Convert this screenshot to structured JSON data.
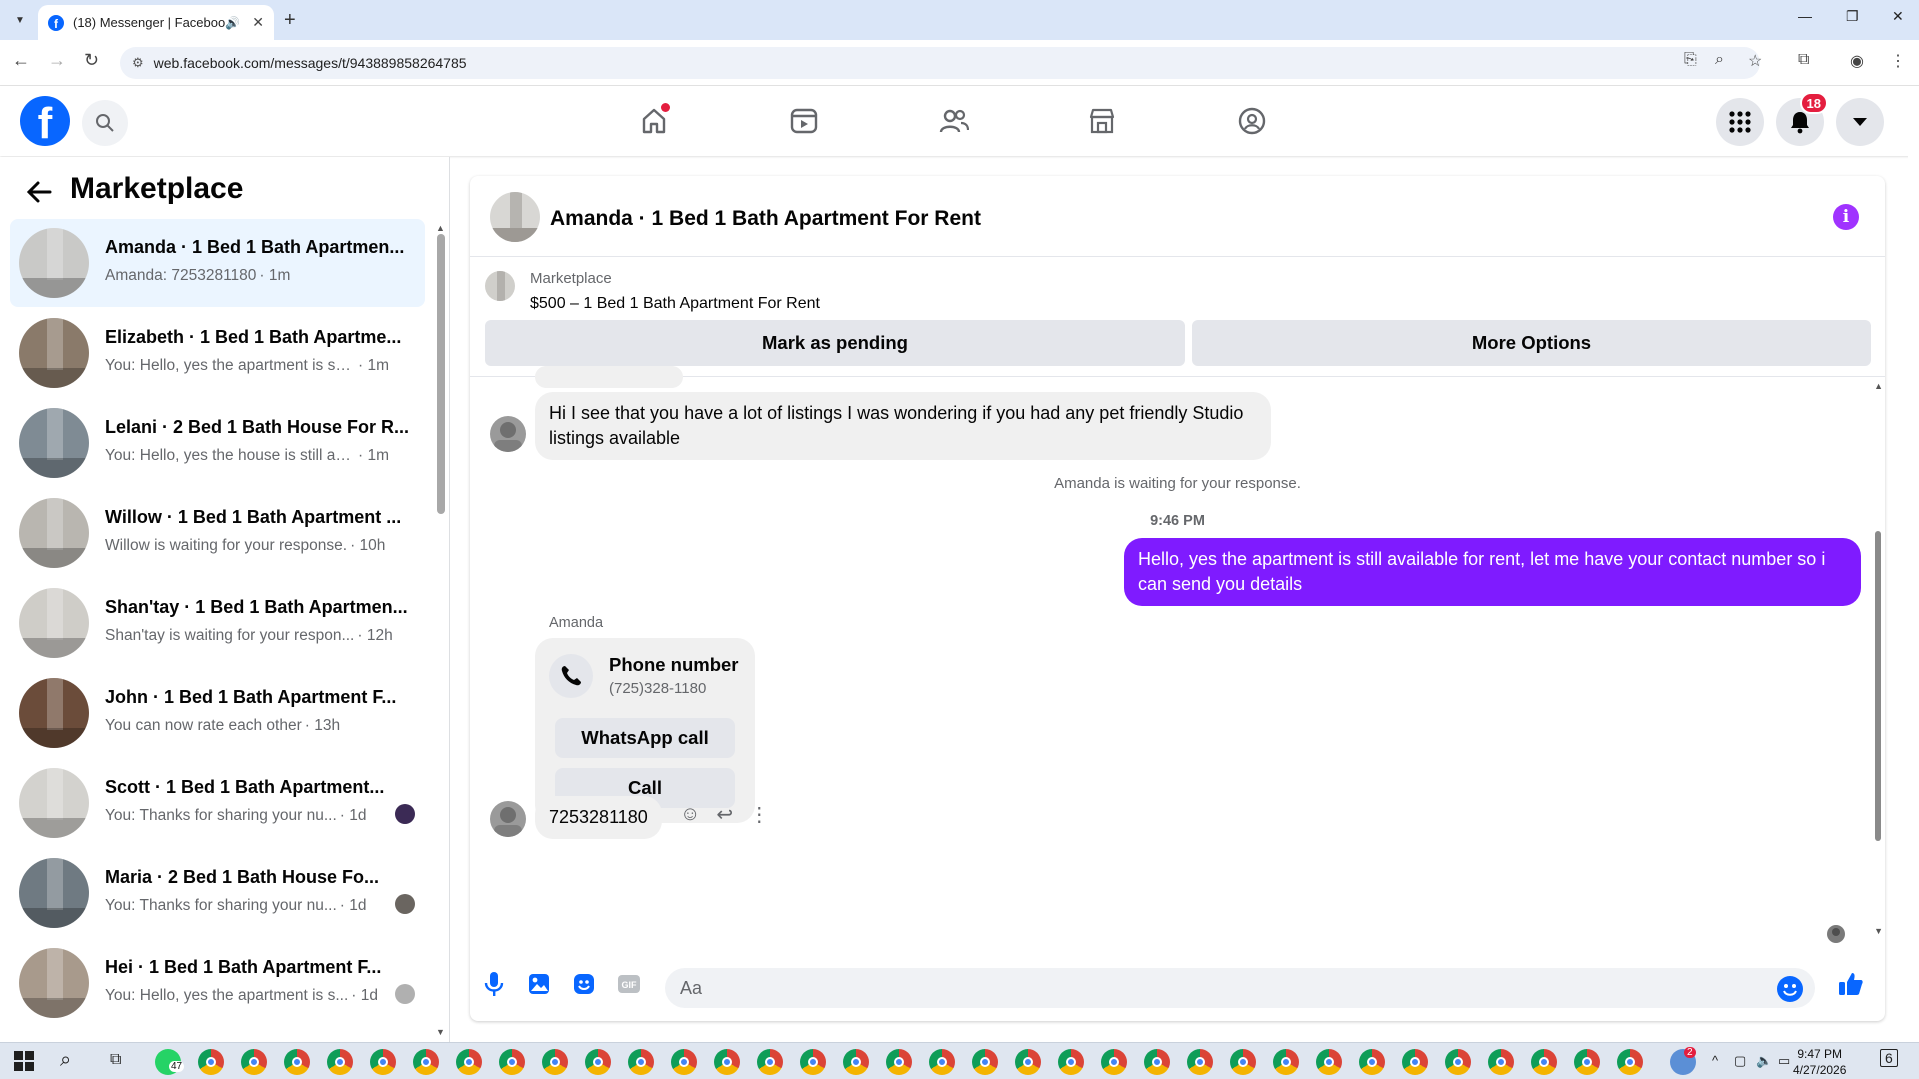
{
  "browser": {
    "tab_title": "(18) Messenger | Facebook",
    "tab_audio_icon": "speaker-icon",
    "url": "web.facebook.com/messages/t/943889858264785"
  },
  "fb_header": {
    "notification_count": "18",
    "nav_icons": [
      "home-icon",
      "video-icon",
      "friends-icon",
      "marketplace-icon",
      "groups-icon"
    ]
  },
  "sidebar": {
    "title": "Marketplace",
    "conversations": [
      {
        "name": "Amanda · 1 Bed 1 Bath Apartmen...",
        "preview": "Amanda: 7253281180",
        "time": " · 1m",
        "active": true,
        "thumb_color": "#c9c9c7"
      },
      {
        "name": "Elizabeth · 1 Bed 1 Bath Apartme...",
        "preview": "You: Hello, yes the apartment is still...",
        "time": " · 1m",
        "thumb_color": "#8a7a6a"
      },
      {
        "name": "Lelani · 2 Bed 1 Bath House For R...",
        "preview": "You: Hello, yes the house is still ava...",
        "time": " · 1m",
        "thumb_color": "#7f8b94"
      },
      {
        "name": "Willow · 1 Bed 1 Bath Apartment ...",
        "preview": "Willow is waiting for your response.",
        "time": " · 10h",
        "thumb_color": "#b9b6b0"
      },
      {
        "name": "Shan'tay · 1 Bed 1 Bath Apartmen...",
        "preview": "Shan'tay is waiting for your respon...",
        "time": " · 12h",
        "thumb_color": "#cfcdc8"
      },
      {
        "name": "John · 1 Bed 1 Bath Apartment F...",
        "preview": "You can now rate each other",
        "time": " · 13h",
        "thumb_color": "#6b4c3a"
      },
      {
        "name": "Scott · 1 Bed 1 Bath Apartment...",
        "preview": "You: Thanks for sharing your nu...",
        "time": " · 1d",
        "thumb_color": "#d3d2ce"
      },
      {
        "name": "Maria · 2 Bed 1 Bath House Fo...",
        "preview": "You: Thanks for sharing your nu...",
        "time": " · 1d",
        "thumb_color": "#6f7a82"
      },
      {
        "name": "Hei · 1 Bed 1 Bath Apartment F...",
        "preview": "You: Hello, yes the apartment is s...",
        "time": " · 1d",
        "thumb_color": "#a89a8c"
      }
    ]
  },
  "chat": {
    "title": "Amanda · 1 Bed 1 Bath Apartment For Rent",
    "marketplace_label": "Marketplace",
    "listing": "$500 – 1 Bed 1 Bath Apartment For Rent",
    "mark_pending": "Mark as pending",
    "more_options": "More Options",
    "incoming_1": "Hi I see that you have a lot of listings I was wondering if you had any pet friendly Studio listings available",
    "waiting_notice": "Amanda is waiting for your response.",
    "timestamp": "9:46 PM",
    "outgoing_1": "Hello, yes the apartment  is still available for rent, let me have your contact number so i can send you  details",
    "sender_name": "Amanda",
    "phone_card_title": "Phone number",
    "phone_card_number": "(725)328-1180",
    "whatsapp_btn": "WhatsApp call",
    "call_btn": "Call",
    "incoming_2": "7253281180",
    "composer_placeholder": "Aa"
  },
  "colors": {
    "brand": "#0866ff",
    "outgoing_bubble": "#7f1bff",
    "info_icon": "#a033ff",
    "badge": "#e41e3f"
  },
  "taskbar": {
    "whatsapp_badge": "47",
    "tray_badge": "2",
    "clock_time": "9:47 PM",
    "clock_date": "4/27/2026",
    "notif_count": "6"
  }
}
